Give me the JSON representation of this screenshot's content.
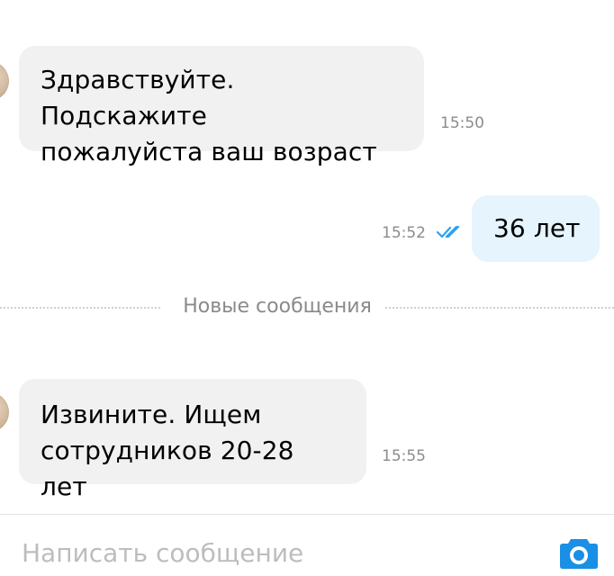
{
  "messages": [
    {
      "direction": "incoming",
      "text": "Здравствуйте. Подскажите\nпожалуйста ваш возраст",
      "time": "15:50"
    },
    {
      "direction": "outgoing",
      "text": "36 лет",
      "time": "15:52",
      "status_icon": "double-check-icon"
    },
    {
      "direction": "incoming",
      "text": "Извините. Ищем\nсотрудников 20-28 лет",
      "time": "15:55"
    }
  ],
  "separator": {
    "label": "Новые сообщения"
  },
  "composer": {
    "placeholder": "Написать сообщение",
    "value": "",
    "send_icon": "camera-icon"
  },
  "colors": {
    "incoming_bubble": "#f1f1f1",
    "outgoing_bubble": "#e5f4fd",
    "read_check": "#2aa3f0",
    "camera_accent": "#1a8fe6",
    "timestamp": "#8c8c8c"
  }
}
